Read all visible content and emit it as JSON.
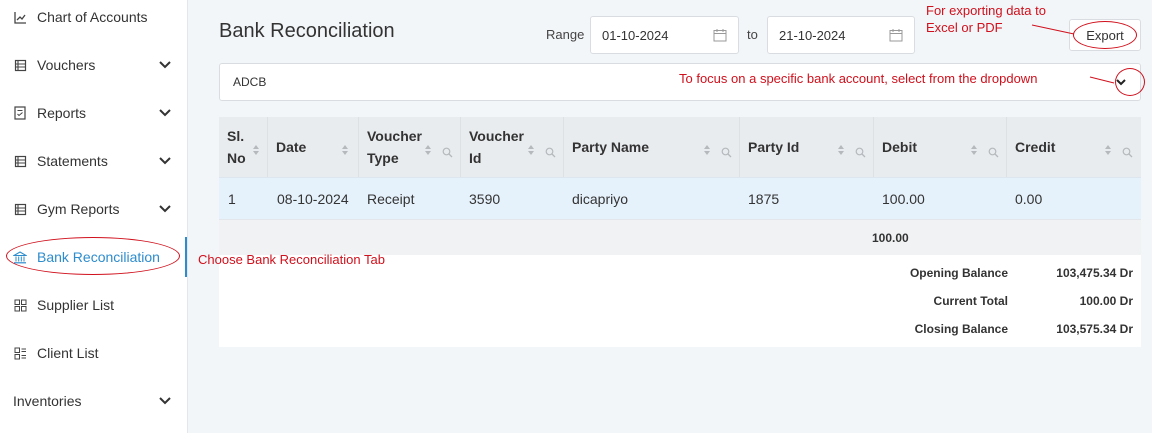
{
  "sidebar": {
    "items": [
      {
        "label": "Chart of Accounts",
        "icon": "chart-icon",
        "expandable": false
      },
      {
        "label": "Vouchers",
        "icon": "voucher-icon",
        "expandable": true
      },
      {
        "label": "Reports",
        "icon": "report-icon",
        "expandable": true
      },
      {
        "label": "Statements",
        "icon": "statement-icon",
        "expandable": true
      },
      {
        "label": "Gym Reports",
        "icon": "gym-report-icon",
        "expandable": true
      },
      {
        "label": "Bank Reconciliation",
        "icon": "bank-icon",
        "expandable": false,
        "active": true
      },
      {
        "label": "Supplier List",
        "icon": "grid-icon",
        "expandable": false
      },
      {
        "label": "Client List",
        "icon": "list-icon",
        "expandable": false
      },
      {
        "label": "Inventories",
        "icon": "",
        "expandable": true
      }
    ]
  },
  "header": {
    "title": "Bank Reconciliation",
    "range_label": "Range",
    "from_date": "01-10-2024",
    "to_label": "to",
    "to_date": "21-10-2024",
    "export_label": "Export"
  },
  "bank_select": {
    "value": "ADCB"
  },
  "table": {
    "columns": [
      "Sl. No",
      "Date",
      "Voucher Type",
      "Voucher Id",
      "Party Name",
      "Party Id",
      "Debit",
      "Credit"
    ],
    "columns_split": [
      [
        "Sl.",
        "No"
      ],
      [
        "Date"
      ],
      [
        "Voucher",
        "Type"
      ],
      [
        "Voucher",
        "Id"
      ],
      [
        "Party Name"
      ],
      [
        "Party Id"
      ],
      [
        "Debit"
      ],
      [
        "Credit"
      ]
    ],
    "rows": [
      [
        "1",
        "08-10-2024",
        "Receipt",
        "3590",
        "dicapriyo",
        "1875",
        "100.00",
        "0.00"
      ]
    ],
    "debit_total": "100.00"
  },
  "summary": {
    "opening_label": "Opening Balance",
    "opening_value": "103,475.34 Dr",
    "current_label": "Current Total",
    "current_value": "100.00 Dr",
    "closing_label": "Closing Balance",
    "closing_value": "103,575.34 Dr"
  },
  "annotations": {
    "export_note_line1": "For exporting data to",
    "export_note_line2": "Excel or PDF",
    "dropdown_note": "To focus on a specific bank account, select from the dropdown",
    "tab_note": "Choose Bank Reconciliation Tab",
    "color": "#d0101c"
  },
  "colors": {
    "accent": "#2d8ccd",
    "row_highlight": "#e6f2fb",
    "header_bg": "#e9ecef"
  }
}
